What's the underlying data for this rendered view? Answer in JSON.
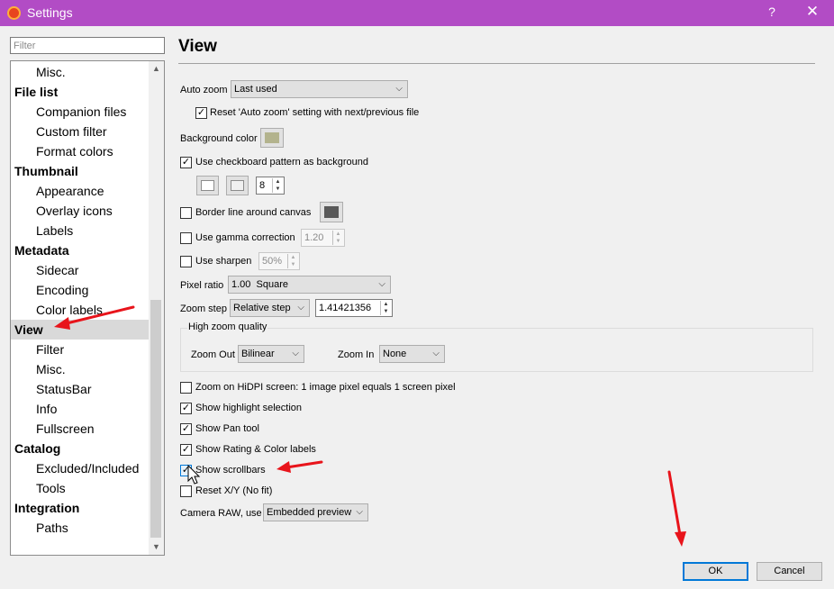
{
  "window": {
    "title": "Settings",
    "help": "?",
    "close": "✕"
  },
  "filter": {
    "placeholder": "Filter",
    "value": ""
  },
  "tree": [
    {
      "label": "Misc.",
      "kind": "sub"
    },
    {
      "label": "File list",
      "kind": "cat"
    },
    {
      "label": "Companion files",
      "kind": "sub"
    },
    {
      "label": "Custom filter",
      "kind": "sub"
    },
    {
      "label": "Format colors",
      "kind": "sub"
    },
    {
      "label": "Thumbnail",
      "kind": "cat"
    },
    {
      "label": "Appearance",
      "kind": "sub"
    },
    {
      "label": "Overlay icons",
      "kind": "sub"
    },
    {
      "label": "Labels",
      "kind": "sub"
    },
    {
      "label": "Metadata",
      "kind": "cat"
    },
    {
      "label": "Sidecar",
      "kind": "sub"
    },
    {
      "label": "Encoding",
      "kind": "sub"
    },
    {
      "label": "Color labels",
      "kind": "sub"
    },
    {
      "label": "View",
      "kind": "cat",
      "selected": true
    },
    {
      "label": "Filter",
      "kind": "sub"
    },
    {
      "label": "Misc.",
      "kind": "sub"
    },
    {
      "label": "StatusBar",
      "kind": "sub"
    },
    {
      "label": "Info",
      "kind": "sub"
    },
    {
      "label": "Fullscreen",
      "kind": "sub"
    },
    {
      "label": "Catalog",
      "kind": "cat"
    },
    {
      "label": "Excluded/Included",
      "kind": "sub"
    },
    {
      "label": "Tools",
      "kind": "sub"
    },
    {
      "label": "Integration",
      "kind": "cat"
    },
    {
      "label": "Paths",
      "kind": "sub"
    }
  ],
  "page": {
    "title": "View",
    "auto_zoom": {
      "label": "Auto zoom",
      "value": "Last used"
    },
    "reset_auto_zoom": {
      "label": "Reset 'Auto zoom' setting with next/previous file",
      "checked": true
    },
    "background_color": {
      "label": "Background color",
      "color": "#b3b38d"
    },
    "checkboard": {
      "label": "Use checkboard pattern as background",
      "checked": true,
      "color1": "#ffffff",
      "color2": "#f0f0f0",
      "size": "8"
    },
    "border_line": {
      "label": "Border line around canvas",
      "checked": false,
      "color": "#595959"
    },
    "gamma": {
      "label": "Use gamma correction",
      "checked": false,
      "value": "1.20"
    },
    "sharpen": {
      "label": "Use sharpen",
      "checked": false,
      "value": "50%"
    },
    "pixel_ratio": {
      "label": "Pixel ratio",
      "value": "1.00  Square"
    },
    "zoom_step": {
      "label": "Zoom step",
      "mode": "Relative step",
      "value": "1.41421356"
    },
    "high_zoom": {
      "title": "High zoom quality",
      "zoom_out_label": "Zoom Out",
      "zoom_out_value": "Bilinear",
      "zoom_in_label": "Zoom In",
      "zoom_in_value": "None"
    },
    "hidpi": {
      "label": "Zoom on HiDPI screen: 1 image pixel equals 1 screen pixel",
      "checked": false
    },
    "highlight_selection": {
      "label": "Show highlight selection",
      "checked": true
    },
    "pan_tool": {
      "label": "Show Pan tool",
      "checked": true
    },
    "rating_labels": {
      "label": "Show Rating & Color labels",
      "checked": true
    },
    "scrollbars": {
      "label": "Show scrollbars",
      "checked": true
    },
    "reset_xy": {
      "label": "Reset X/Y (No fit)",
      "checked": false
    },
    "camera_raw": {
      "label": "Camera RAW, use",
      "value": "Embedded preview"
    }
  },
  "buttons": {
    "ok": "OK",
    "cancel": "Cancel"
  },
  "colors": {
    "titlebar": "#b24cc5",
    "annotation_arrow": "#e8141b",
    "ok_border": "#0078d7"
  }
}
